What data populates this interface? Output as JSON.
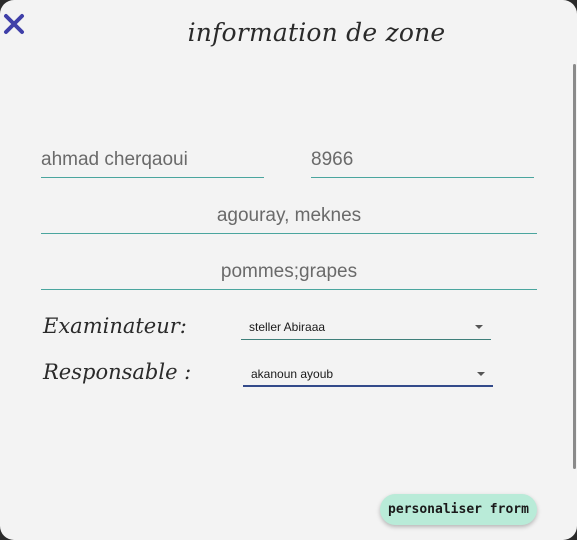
{
  "window": {
    "title": "information de zone"
  },
  "form": {
    "name_value": "ahmad cherqaoui",
    "code_value": "8966",
    "address_value": "agouray, meknes",
    "products_value": "pommes;grapes",
    "examinateur_label": "Examinateur:",
    "examinateur_value": "steller Abiraaa",
    "responsable_label": "Responsable :",
    "responsable_value": "akanoun ayoub"
  },
  "actions": {
    "personalize_label": "personaliser frorm"
  },
  "colors": {
    "close_icon": "#3f3fa8",
    "field_underline": "#4aa59e",
    "button_bg": "#b9ebd8",
    "responsable_underline": "#334a8a"
  },
  "icons": {
    "close": "close-icon",
    "dropdown": "chevron-down-icon"
  }
}
